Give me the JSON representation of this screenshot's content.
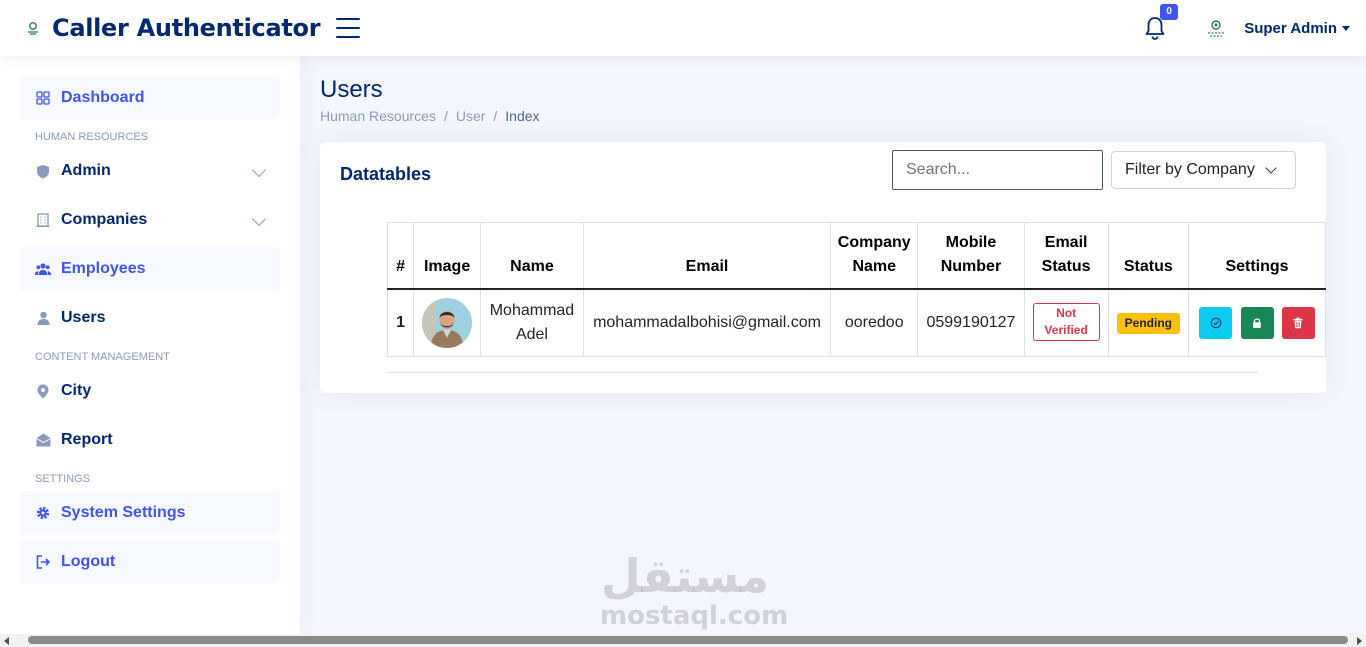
{
  "app": {
    "title": "Caller Authenticator"
  },
  "header": {
    "notification_count": "0",
    "user_name": "Super Admin"
  },
  "sidebar": {
    "items": [
      {
        "label": "Dashboard"
      },
      {
        "label": "Admin"
      },
      {
        "label": "Companies"
      },
      {
        "label": "Employees"
      },
      {
        "label": "Users"
      },
      {
        "label": "City"
      },
      {
        "label": "Report"
      },
      {
        "label": "System Settings"
      },
      {
        "label": "Logout"
      }
    ],
    "headings": [
      "HUMAN RESOURCES",
      "CONTENT MANAGEMENT",
      "SETTINGS"
    ]
  },
  "page": {
    "title": "Users",
    "breadcrumb": [
      "Human Resources",
      "User",
      "Index"
    ]
  },
  "card": {
    "title": "Datatables",
    "search_placeholder": "Search...",
    "filter_label": "Filter by Company"
  },
  "table": {
    "headers": [
      "#",
      "Image",
      "Name",
      "Email",
      "Company Name",
      "Mobile Number",
      "Email Status",
      "Status",
      "Settings"
    ],
    "rows": [
      {
        "num": "1",
        "name": "Mohammad Adel",
        "email": "mohammadalbohisi@gmail.com",
        "company": "ooredoo",
        "mobile": "0599190127",
        "email_status": "Not Verified",
        "status": "Pending"
      }
    ]
  },
  "watermark": {
    "arabic": "مستقل",
    "latin": "mostaql.com"
  },
  "colors": {
    "brand": "#012970",
    "accent": "#4154f1",
    "info": "#0dcaf0",
    "success": "#198754",
    "danger": "#dc3545",
    "warning": "#ffc107"
  }
}
